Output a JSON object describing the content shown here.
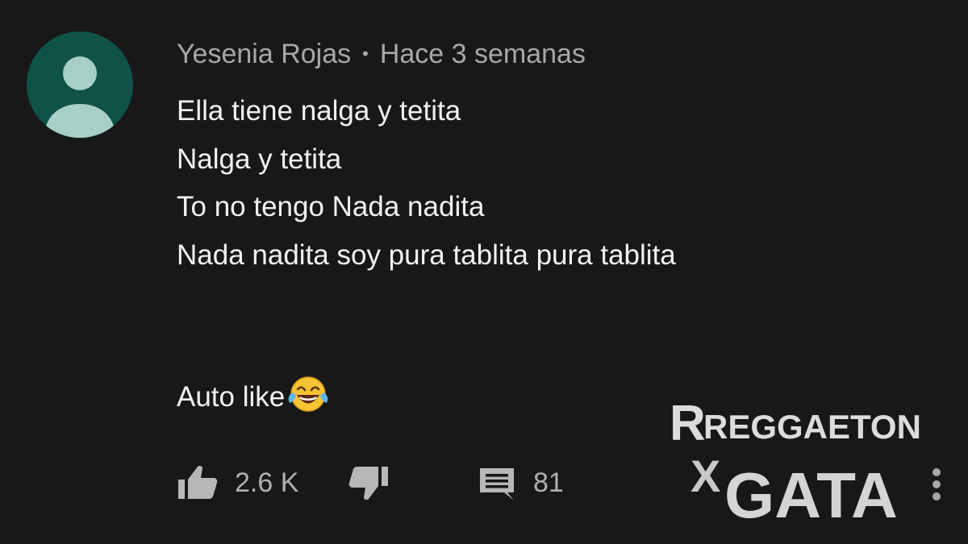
{
  "comment": {
    "author": "Yesenia Rojas",
    "separator": "•",
    "time": "Hace 3 semanas",
    "lines": [
      "Ella tiene nalga y tetita",
      "Nalga y tetita",
      "To no tengo Nada nadita",
      "Nada nadita soy pura tablita pura tablita"
    ],
    "extra_text": "Auto like",
    "emoji": "face-with-tears-of-joy"
  },
  "actions": {
    "like_count": "2.6 K",
    "reply_count": "81"
  },
  "watermark": {
    "line1": "REGGAETON",
    "line2_x": "X",
    "line2": "GATA"
  },
  "colors": {
    "background": "#181818",
    "avatar_bg": "#0f5248",
    "avatar_fg": "#a8cfc6",
    "text_primary": "#f1f1f1",
    "text_secondary": "#a8a8a8"
  }
}
